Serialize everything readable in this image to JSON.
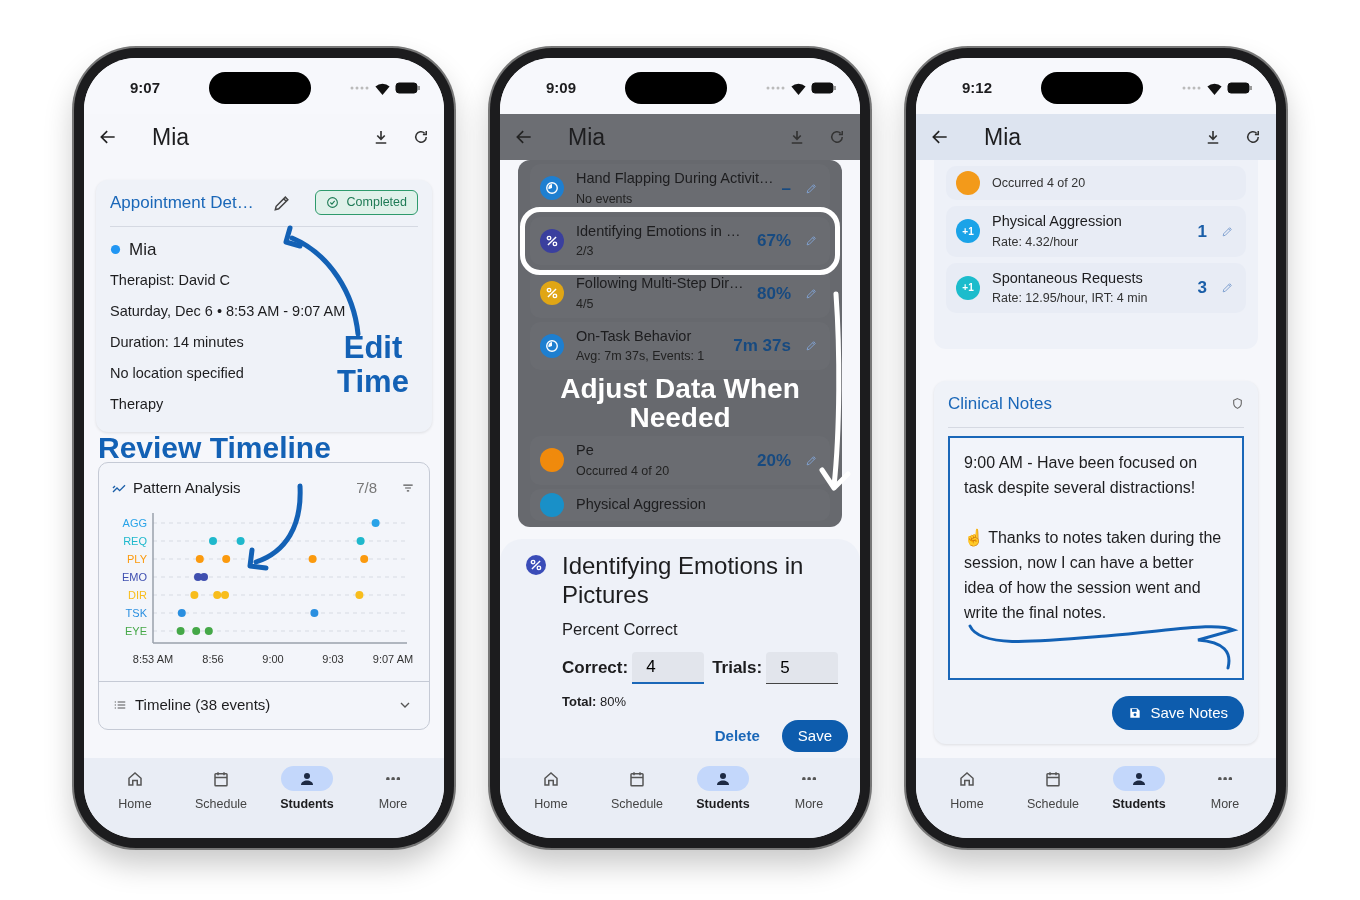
{
  "phones": [
    {
      "kind": "appointment",
      "status_time": "9:07",
      "title": "Mia",
      "header_elevated": false,
      "modal_open": false,
      "appointment_card": {
        "title": "Appointment Det…",
        "badge": "Completed",
        "student": "Mia",
        "lines": [
          "Therapist: David C",
          "Saturday, Dec 6 • 8:53 AM - 9:07 AM",
          "Duration: 14 minutes",
          "No location specified",
          "Therapy"
        ],
        "callout": "Edit Time"
      },
      "section_callout": "Review Timeline",
      "pattern_card": {
        "title": "Pattern Analysis",
        "count": "7/8",
        "timeline": "Timeline (38 events)",
        "timeline_expanded": false,
        "timeline_chart": {
          "time_labels": [
            "8:53 AM",
            "8:56",
            "9:00",
            "9:03",
            "9:07 AM"
          ],
          "lanes": [
            {
              "label": "AGG",
              "color": "#29a3e8"
            },
            {
              "label": "REQ",
              "color": "#1fb8cc"
            },
            {
              "label": "PLY",
              "color": "#fb9a0e"
            },
            {
              "label": "EMO",
              "color": "#3f4fb0"
            },
            {
              "label": "DIR",
              "color": "#f8bd1c"
            },
            {
              "label": "TSK",
              "color": "#2a8fe0"
            },
            {
              "label": "EYE",
              "color": "#45a848"
            }
          ]
        }
      },
      "nav": [
        {
          "kind": "home",
          "label": "Home",
          "selected": false
        },
        {
          "kind": "calendar",
          "label": "Schedule",
          "selected": false
        },
        {
          "kind": "person",
          "label": "Students",
          "selected": true
        },
        {
          "kind": "more",
          "label": "More",
          "selected": false
        }
      ]
    },
    {
      "kind": "data_entry",
      "status_time": "9:09",
      "title": "Mia",
      "header_elevated": false,
      "modal_open": true,
      "rows": [
        {
          "kind": "timer",
          "color": "#1e7fd0",
          "title": "Hand Flapping During Activit…",
          "sub": "No events",
          "value": "–",
          "highlighted": false
        },
        {
          "kind": "percent",
          "color": "#3a3f9e",
          "title": "Identifying Emotions in …",
          "sub": "2/3",
          "value": "67%",
          "highlighted": true
        },
        {
          "kind": "percent",
          "color": "#e0a615",
          "title": "Following Multi-Step Dir…",
          "sub": "4/5",
          "value": "80%",
          "highlighted": false
        },
        {
          "kind": "timer",
          "color": "#1e7fd0",
          "title": "On-Task Behavior",
          "sub": "Avg: 7m 37s, Events: 1",
          "value": "7m 37s",
          "highlighted": false
        },
        {
          "kind": "annotation",
          "text": "Adjust Data When Needed"
        },
        {
          "kind": "moon",
          "color": "#f08a0c",
          "title": "Pe",
          "sub": "Occurred 4 of 20",
          "value": "20%",
          "highlighted": false
        },
        {
          "kind": "counter",
          "color": "#1990c8",
          "title": "Physical Aggression",
          "highlighted": false
        }
      ],
      "sheet": {
        "kind": "percent",
        "color": "#3a4cb8",
        "title": "Identifying Emotions in Pictures",
        "subtitle": "Percent Correct",
        "fields": [
          {
            "label": "Correct:",
            "value": "4",
            "focused": true
          },
          {
            "label": "Trials:",
            "value": "5",
            "focused": false
          }
        ],
        "total": "**Total:** 80%",
        "secondary_button": "Delete",
        "primary_button": "Save"
      },
      "nav": [
        {
          "kind": "home",
          "label": "Home",
          "selected": false
        },
        {
          "kind": "calendar",
          "label": "Schedule",
          "selected": false
        },
        {
          "kind": "person",
          "label": "Students",
          "selected": true
        },
        {
          "kind": "more",
          "label": "More",
          "selected": false
        }
      ]
    },
    {
      "kind": "notes",
      "status_time": "9:12",
      "title": "Mia",
      "header_elevated": true,
      "modal_open": false,
      "rows": [
        {
          "kind": "moon",
          "color": "#f39a1a",
          "sub": "Occurred 4 of 20"
        },
        {
          "kind": "counter",
          "color": "#1aa3e8",
          "badge": "+1",
          "title": "Physical Aggression",
          "sub": "Rate: 4.32/hour",
          "value": "1"
        },
        {
          "kind": "counter",
          "color": "#1cbccc",
          "badge": "+1",
          "title": "Spontaneous Requests",
          "sub": "Rate: 12.95/hour, IRT: 4 min",
          "value": "3"
        }
      ],
      "notes_card": {
        "title": "Clinical Notes",
        "text": "9:00 AM - Have been focused on task despite several distractions!\n\n☝ Thanks to notes taken during the session, now I can have a better idea of how the session went and write the final notes.",
        "focused": true,
        "button": "Save Notes"
      },
      "nav": [
        {
          "kind": "home",
          "label": "Home",
          "selected": false
        },
        {
          "kind": "calendar",
          "label": "Schedule",
          "selected": false
        },
        {
          "kind": "person",
          "label": "Students",
          "selected": true
        },
        {
          "kind": "more",
          "label": "More",
          "selected": false
        }
      ]
    }
  ]
}
